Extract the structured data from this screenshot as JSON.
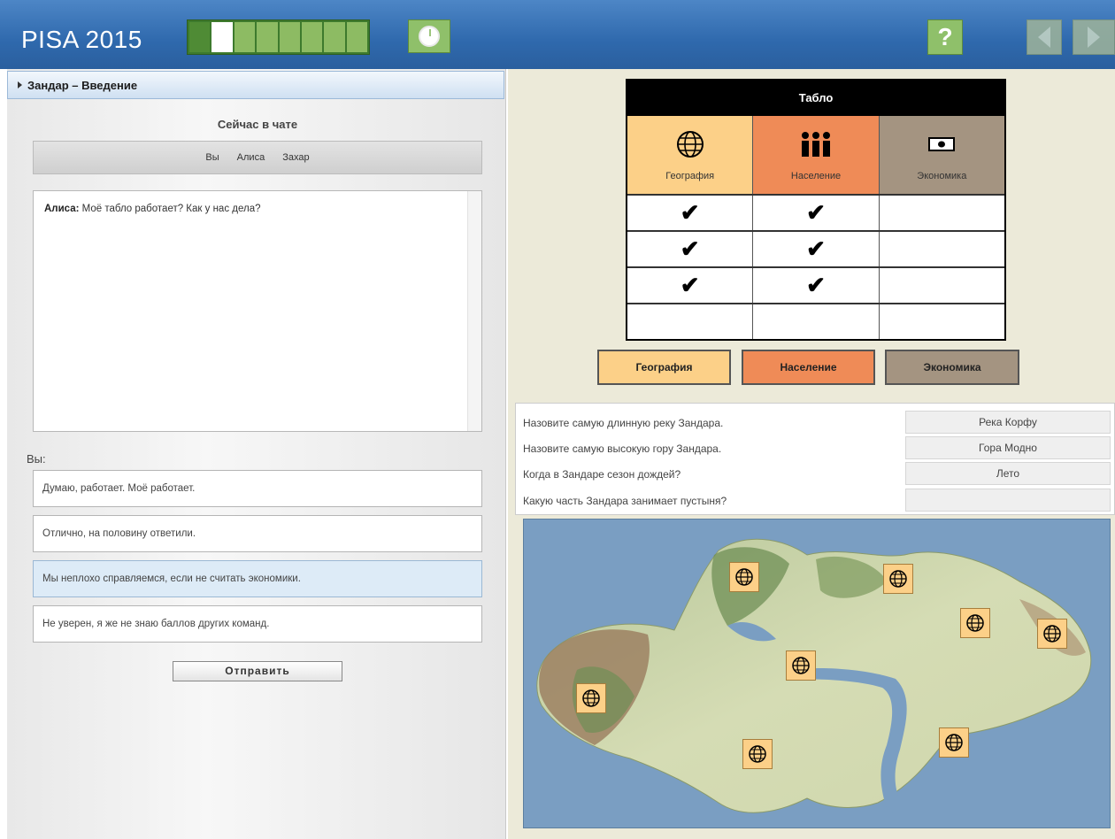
{
  "header": {
    "brand": "PISA 2015",
    "progress": {
      "segments": 8,
      "done": 1,
      "current": 2
    },
    "help_label": "?"
  },
  "left_panel": {
    "section_title": "Зандар – Введение",
    "chat_title": "Сейчас в чате",
    "participants": [
      "Вы",
      "Алиса",
      "Захар"
    ],
    "chat_log": [
      {
        "speaker": "Алиса:",
        "text": "Моё табло работает? Как у нас дела?"
      }
    ],
    "you_label": "Вы:",
    "options": [
      "Думаю, работает. Моё работает.",
      "Отлично, на половину ответили.",
      "Мы неплохо справляемся, если не считать экономики.",
      "Не уверен, я же не знаю баллов других команд."
    ],
    "selected_option": 2,
    "send_button": "Отправить"
  },
  "scoreboard": {
    "title": "Табло",
    "categories": [
      {
        "label": "География",
        "icon": "globe-icon",
        "color": "#fcd088"
      },
      {
        "label": "Население",
        "icon": "people-icon",
        "color": "#ef8b57"
      },
      {
        "label": "Экономика",
        "icon": "money-icon",
        "color": "#a49481"
      }
    ],
    "rows": [
      [
        "✔",
        "✔",
        ""
      ],
      [
        "✔",
        "✔",
        ""
      ],
      [
        "✔",
        "✔",
        ""
      ],
      [
        "",
        "",
        ""
      ]
    ]
  },
  "category_buttons": [
    "География",
    "Население",
    "Экономика"
  ],
  "questions": [
    {
      "question": "Назовите самую длинную реку Зандара.",
      "answer": "Река Корфу"
    },
    {
      "question": "Назовите самую высокую гору Зандара.",
      "answer": "Гора Модно"
    },
    {
      "question": "Когда в Зандаре сезон дождей?",
      "answer": "Лето"
    },
    {
      "question": "Какую часть Зандара занимает пустыня?",
      "answer": ""
    }
  ],
  "map": {
    "pin_icon": "globe-icon",
    "pin_count": 8,
    "colors": {
      "sea": "#7a9ec2",
      "land": "#c9d4a8",
      "forest": "#6f8f55",
      "mountain": "#9c7b5c"
    }
  }
}
